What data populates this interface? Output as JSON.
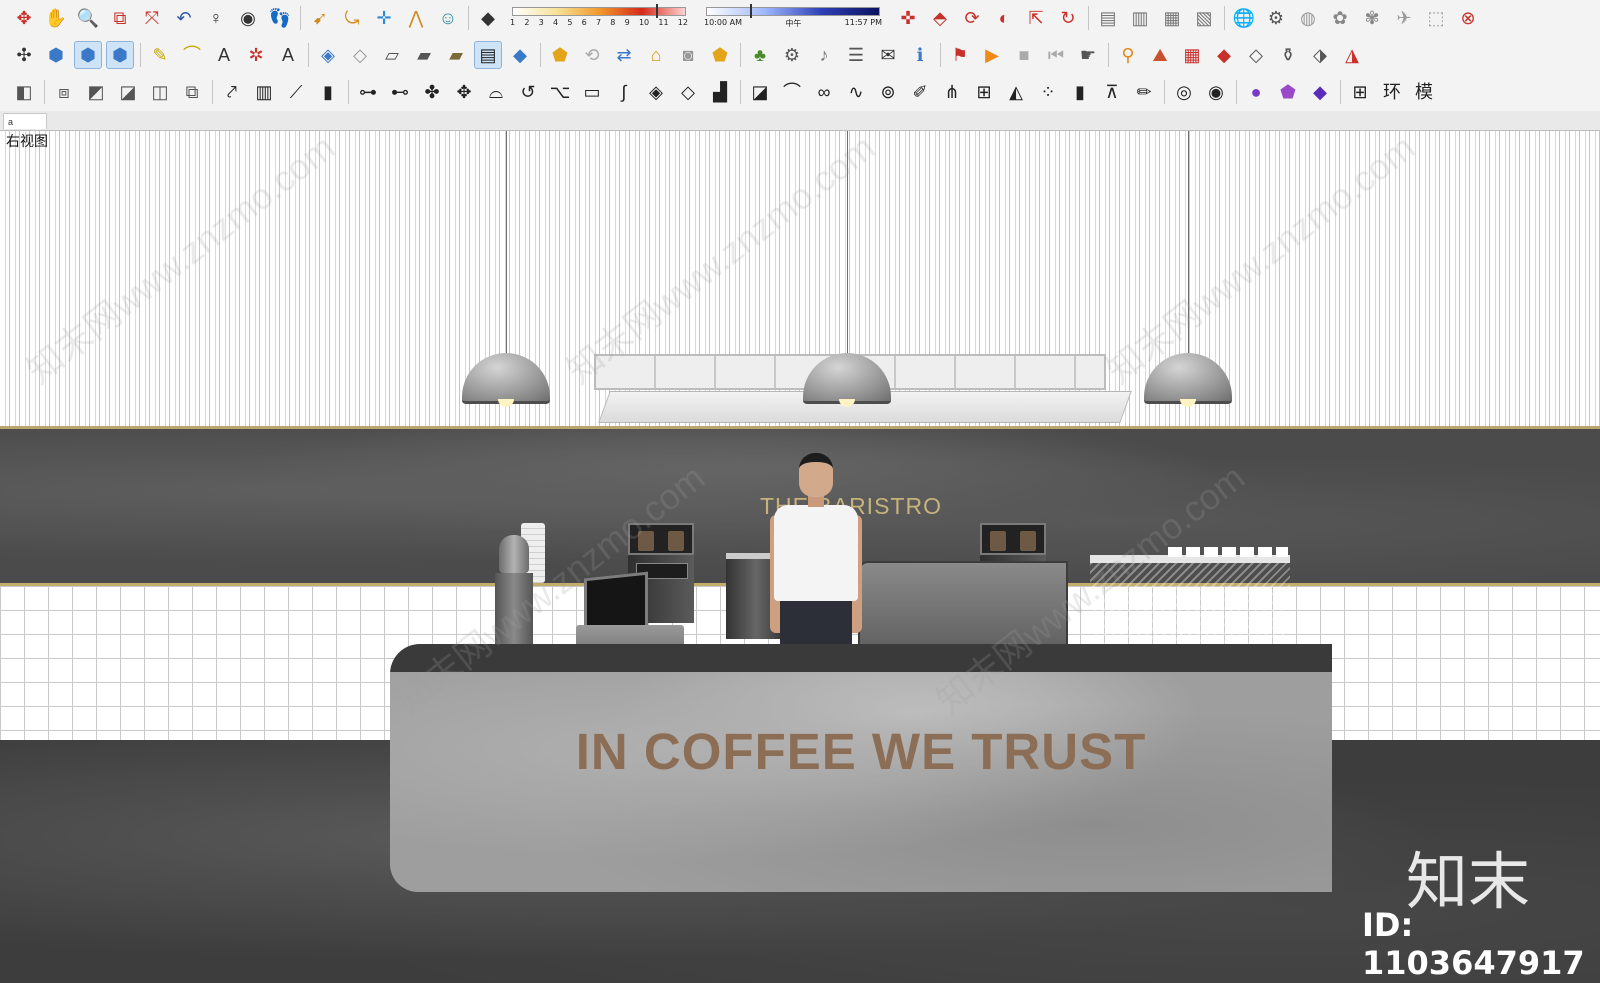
{
  "toolbars": {
    "row1_icons": [
      {
        "name": "orbit-icon",
        "glyph": "✥",
        "color": "#c8302a"
      },
      {
        "name": "pan-icon",
        "glyph": "✋",
        "color": "#d08a1c"
      },
      {
        "name": "zoom-icon",
        "glyph": "🔍",
        "color": "#2b5aa8"
      },
      {
        "name": "zoom-window-icon",
        "glyph": "⧉",
        "color": "#c8302a"
      },
      {
        "name": "zoom-extents-icon",
        "glyph": "⤧",
        "color": "#c8302a"
      },
      {
        "name": "previous-view-icon",
        "glyph": "↶",
        "color": "#2b5aa8"
      },
      {
        "name": "position-camera-icon",
        "glyph": "♀",
        "color": "#333333"
      },
      {
        "name": "look-around-icon",
        "glyph": "◉",
        "color": "#333333"
      },
      {
        "name": "walk-icon",
        "glyph": "👣",
        "color": "#333333"
      },
      {
        "name": "select-icon",
        "glyph": "➹",
        "color": "#d08a1c"
      },
      {
        "name": "follow-me-icon",
        "glyph": "⤿",
        "color": "#d08a1c"
      },
      {
        "name": "move-icon",
        "glyph": "✛",
        "color": "#2b8ad8"
      },
      {
        "name": "sandbox-icon",
        "glyph": "⋀",
        "color": "#d08a1c"
      },
      {
        "name": "person-icon",
        "glyph": "☺",
        "color": "#2a8a9a"
      },
      {
        "name": "shadows-toggle-icon",
        "glyph": "◆",
        "color": "#333333"
      },
      {
        "name": "move-tool-red-icon",
        "glyph": "✜",
        "color": "#c8302a"
      },
      {
        "name": "push-pull-icon",
        "glyph": "⬘",
        "color": "#c8302a"
      },
      {
        "name": "rotate-icon",
        "glyph": "⟳",
        "color": "#c8302a"
      },
      {
        "name": "tape-icon",
        "glyph": "◐",
        "color": "#c8302a"
      },
      {
        "name": "scale-icon",
        "glyph": "⇱",
        "color": "#c8302a"
      },
      {
        "name": "offset-icon",
        "glyph": "↻",
        "color": "#c8302a"
      },
      {
        "name": "layer-manager-icon",
        "glyph": "▤",
        "color": "#777777"
      },
      {
        "name": "layer-add-icon",
        "glyph": "▥",
        "color": "#777777"
      },
      {
        "name": "layer-delete-icon",
        "glyph": "▦",
        "color": "#777777"
      },
      {
        "name": "layer-props-icon",
        "glyph": "▧",
        "color": "#777777"
      },
      {
        "name": "geo-location-icon",
        "glyph": "🌐",
        "color": "#444444"
      },
      {
        "name": "component-icon",
        "glyph": "⚙",
        "color": "#555555"
      },
      {
        "name": "material-icon",
        "glyph": "◍",
        "color": "#999999"
      },
      {
        "name": "reel-icon",
        "glyph": "✿",
        "color": "#888888"
      },
      {
        "name": "reel-2-icon",
        "glyph": "✾",
        "color": "#888888"
      },
      {
        "name": "send-icon",
        "glyph": "✈",
        "color": "#999999"
      },
      {
        "name": "box-icon",
        "glyph": "⬚",
        "color": "#999999"
      },
      {
        "name": "close-icon",
        "glyph": "⊗",
        "color": "#c8302a"
      }
    ],
    "row2_icons": [
      {
        "name": "axes-icon",
        "glyph": "✣",
        "color": "#333333"
      },
      {
        "name": "iso-view-icon",
        "glyph": "⬢",
        "color": "#3a78c8"
      },
      {
        "name": "top-view-icon",
        "glyph": "⬢",
        "color": "#3a78c8",
        "active": true
      },
      {
        "name": "front-view-icon",
        "glyph": "⬢",
        "color": "#3a78c8",
        "active": true
      },
      {
        "name": "dimension-icon",
        "glyph": "✎",
        "color": "#c9a400"
      },
      {
        "name": "protractor-icon",
        "glyph": "⌒",
        "color": "#c9a400"
      },
      {
        "name": "text-icon",
        "glyph": "A",
        "color": "#333333"
      },
      {
        "name": "axes-tool-icon",
        "glyph": "✲",
        "color": "#c8302a"
      },
      {
        "name": "3d-text-icon",
        "glyph": "A",
        "color": "#333333"
      },
      {
        "name": "section-plane-icon",
        "glyph": "◈",
        "color": "#3a78c8"
      },
      {
        "name": "wireframe-icon",
        "glyph": "◇",
        "color": "#999999"
      },
      {
        "name": "hidden-line-icon",
        "glyph": "▱",
        "color": "#555555"
      },
      {
        "name": "shaded-icon",
        "glyph": "▰",
        "color": "#555555"
      },
      {
        "name": "textured-icon",
        "glyph": "▰",
        "color": "#7a6a3a"
      },
      {
        "name": "monochrome-icon",
        "glyph": "▤",
        "color": "#222222",
        "active": true
      },
      {
        "name": "xray-icon",
        "glyph": "◆",
        "color": "#3a78c8"
      },
      {
        "name": "warehouse-icon",
        "glyph": "⬟",
        "color": "#e3a418"
      },
      {
        "name": "refresh-icon",
        "glyph": "⟲",
        "color": "#aaaaaa"
      },
      {
        "name": "share-model-icon",
        "glyph": "⇄",
        "color": "#3a78c8"
      },
      {
        "name": "camera-icon",
        "glyph": "⌂",
        "color": "#d0a018"
      },
      {
        "name": "photo-icon",
        "glyph": "◙",
        "color": "#999999"
      },
      {
        "name": "extension-warehouse-icon",
        "glyph": "⬟",
        "color": "#e3a418"
      },
      {
        "name": "tree-icon",
        "glyph": "♣",
        "color": "#4a8a2a"
      },
      {
        "name": "render-settings-icon",
        "glyph": "⚙",
        "color": "#555555"
      },
      {
        "name": "sound-icon",
        "glyph": "♪",
        "color": "#777777"
      },
      {
        "name": "settings-icon",
        "glyph": "☰",
        "color": "#555555"
      },
      {
        "name": "chat-icon",
        "glyph": "✉",
        "color": "#333333"
      },
      {
        "name": "info-icon",
        "glyph": "ℹ",
        "color": "#3a78c8"
      },
      {
        "name": "flag-icon",
        "glyph": "⚑",
        "color": "#c8302a"
      },
      {
        "name": "play-icon",
        "glyph": "▶",
        "color": "#f08a18"
      },
      {
        "name": "stop-icon",
        "glyph": "■",
        "color": "#aaaaaa"
      },
      {
        "name": "rewind-icon",
        "glyph": "⏮",
        "color": "#aaaaaa"
      },
      {
        "name": "hand-icon",
        "glyph": "☛",
        "color": "#555555"
      },
      {
        "name": "pin-icon",
        "glyph": "⚲",
        "color": "#e08a1a"
      },
      {
        "name": "terrain-icon",
        "glyph": "⛰",
        "color": "#c8502a"
      },
      {
        "name": "map-icon",
        "glyph": "▦",
        "color": "#c8302a"
      },
      {
        "name": "skp-icon",
        "glyph": "◆",
        "color": "#c8302a"
      },
      {
        "name": "export-icon",
        "glyph": "◇",
        "color": "#555555"
      },
      {
        "name": "bucket-icon",
        "glyph": "⚱",
        "color": "#555555"
      },
      {
        "name": "photo-match-icon",
        "glyph": "⬗",
        "color": "#555555"
      },
      {
        "name": "triangle-icon",
        "glyph": "◮",
        "color": "#c8302a"
      }
    ],
    "row3_icons": [
      {
        "name": "solid-tools-icon",
        "glyph": "◧",
        "color": "#555555"
      },
      {
        "name": "union-icon",
        "glyph": "⧈",
        "color": "#555555"
      },
      {
        "name": "subtract-icon",
        "glyph": "◩",
        "color": "#555555"
      },
      {
        "name": "intersect-icon",
        "glyph": "◪",
        "color": "#555555"
      },
      {
        "name": "trim-icon",
        "glyph": "◫",
        "color": "#555555"
      },
      {
        "name": "split-icon",
        "glyph": "⧉",
        "color": "#555555"
      },
      {
        "name": "stairs-icon",
        "glyph": "⤤",
        "color": "#222222"
      },
      {
        "name": "column-icon",
        "glyph": "▥",
        "color": "#222222"
      },
      {
        "name": "ramp-icon",
        "glyph": "⟋",
        "color": "#222222"
      },
      {
        "name": "bars-icon",
        "glyph": "▮",
        "color": "#222222"
      },
      {
        "name": "railing-icon",
        "glyph": "⊶",
        "color": "#222222"
      },
      {
        "name": "rail-icon",
        "glyph": "⊷",
        "color": "#222222"
      },
      {
        "name": "plant-icon",
        "glyph": "✤",
        "color": "#222222"
      },
      {
        "name": "palm-icon",
        "glyph": "✥",
        "color": "#222222"
      },
      {
        "name": "arch-icon",
        "glyph": "⌓",
        "color": "#222222"
      },
      {
        "name": "spiral-icon",
        "glyph": "↺",
        "color": "#222222"
      },
      {
        "name": "branch-icon",
        "glyph": "⌥",
        "color": "#222222"
      },
      {
        "name": "pipe-icon",
        "glyph": "▭",
        "color": "#222222"
      },
      {
        "name": "curve-icon",
        "glyph": "∫",
        "color": "#222222"
      },
      {
        "name": "lattice-icon",
        "glyph": "◈",
        "color": "#222222"
      },
      {
        "name": "lattice-2-icon",
        "glyph": "◇",
        "color": "#222222"
      },
      {
        "name": "building-icon",
        "glyph": "▟",
        "color": "#222222"
      },
      {
        "name": "window-icon",
        "glyph": "◪",
        "color": "#222222"
      },
      {
        "name": "dome-icon",
        "glyph": "⌒",
        "color": "#222222"
      },
      {
        "name": "chain-icon",
        "glyph": "∞",
        "color": "#222222"
      },
      {
        "name": "wave-icon",
        "glyph": "∿",
        "color": "#222222"
      },
      {
        "name": "swirl-icon",
        "glyph": "⊚",
        "color": "#222222"
      },
      {
        "name": "pencil-icon",
        "glyph": "✐",
        "color": "#222222"
      },
      {
        "name": "fence-icon",
        "glyph": "⋔",
        "color": "#222222"
      },
      {
        "name": "colonnade-icon",
        "glyph": "⊞",
        "color": "#222222"
      },
      {
        "name": "mirror-icon",
        "glyph": "◭",
        "color": "#222222"
      },
      {
        "name": "grid-array-icon",
        "glyph": "⁘",
        "color": "#222222"
      },
      {
        "name": "book-icon",
        "glyph": "▮",
        "color": "#222222"
      },
      {
        "name": "compass-icon",
        "glyph": "⊼",
        "color": "#222222"
      },
      {
        "name": "brush-icon",
        "glyph": "✏",
        "color": "#222222"
      },
      {
        "name": "circle-mod-icon",
        "glyph": "◎",
        "color": "#222222"
      },
      {
        "name": "circle-s-icon",
        "glyph": "◉",
        "color": "#222222"
      },
      {
        "name": "material-purple-icon",
        "glyph": "●",
        "color": "#7a3ac8"
      },
      {
        "name": "material-shield-icon",
        "glyph": "⬟",
        "color": "#9a4ac8"
      },
      {
        "name": "material-tag-icon",
        "glyph": "◆",
        "color": "#5a2ab8"
      },
      {
        "name": "grid-plugin-icon",
        "glyph": "⊞",
        "color": "#222222"
      },
      {
        "name": "huan-plugin-icon",
        "glyph": "环",
        "color": "#222222"
      },
      {
        "name": "mo-plugin-icon",
        "glyph": "模",
        "color": "#222222"
      }
    ],
    "shadow_months": [
      "1",
      "2",
      "3",
      "4",
      "5",
      "6",
      "7",
      "8",
      "9",
      "10",
      "11",
      "12"
    ],
    "shadow_time": {
      "start": "10:00 AM",
      "mid": "中午",
      "end": "11:57 PM"
    }
  },
  "scene_tab": {
    "label": "a"
  },
  "viewport": {
    "view_name": "右视图",
    "brand_sign": "THE BARISTRO",
    "counter_slogan": "IN COFFEE WE TRUST",
    "watermarks": {
      "repeat_text": "知末网www.znzmo.com",
      "logo_text": "知末",
      "asset_id": "ID: 1103647917"
    }
  }
}
